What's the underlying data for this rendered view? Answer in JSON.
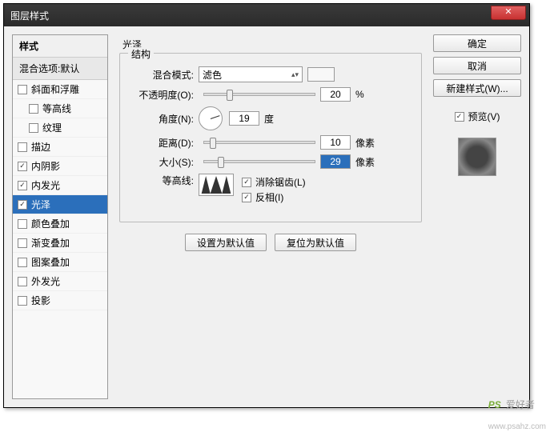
{
  "title": "图层样式",
  "close": "✕",
  "left": {
    "header": "样式",
    "blending": "混合选项:默认",
    "items": [
      {
        "label": "斜面和浮雕",
        "checked": false,
        "indent": false
      },
      {
        "label": "等高线",
        "checked": false,
        "indent": true
      },
      {
        "label": "纹理",
        "checked": false,
        "indent": true
      },
      {
        "label": "描边",
        "checked": false,
        "indent": false
      },
      {
        "label": "内阴影",
        "checked": true,
        "indent": false
      },
      {
        "label": "内发光",
        "checked": true,
        "indent": false
      },
      {
        "label": "光泽",
        "checked": true,
        "indent": false,
        "selected": true
      },
      {
        "label": "颜色叠加",
        "checked": false,
        "indent": false
      },
      {
        "label": "渐变叠加",
        "checked": false,
        "indent": false
      },
      {
        "label": "图案叠加",
        "checked": false,
        "indent": false
      },
      {
        "label": "外发光",
        "checked": false,
        "indent": false
      },
      {
        "label": "投影",
        "checked": false,
        "indent": false
      }
    ]
  },
  "center": {
    "section": "光泽",
    "group": "结构",
    "blendMode": {
      "label": "混合模式:",
      "value": "滤色"
    },
    "opacity": {
      "label": "不透明度(O):",
      "value": "20",
      "unit": "%",
      "pos": 20
    },
    "angle": {
      "label": "角度(N):",
      "value": "19",
      "unit": "度"
    },
    "distance": {
      "label": "距离(D):",
      "value": "10",
      "unit": "像素",
      "pos": 5
    },
    "size": {
      "label": "大小(S):",
      "value": "29",
      "unit": "像素",
      "pos": 12
    },
    "contour": {
      "label": "等高线:"
    },
    "antialias": "消除锯齿(L)",
    "invert": "反相(I)",
    "setDefault": "设置为默认值",
    "resetDefault": "复位为默认值"
  },
  "right": {
    "ok": "确定",
    "cancel": "取消",
    "newStyle": "新建样式(W)...",
    "preview": "预览(V)"
  },
  "watermark": {
    "main": "PS",
    "sub": "爱好者",
    "url": "www.psahz.com"
  }
}
